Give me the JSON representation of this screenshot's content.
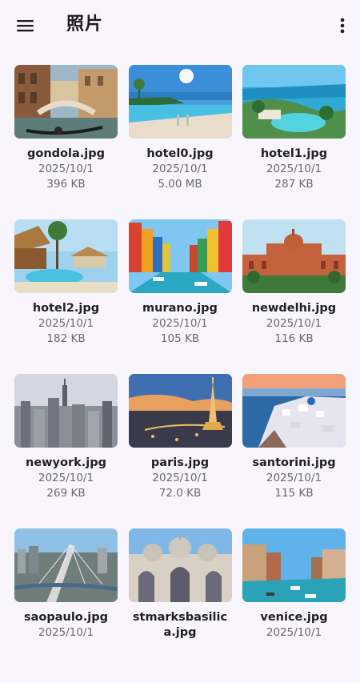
{
  "app_bar": {
    "title": "照片",
    "menu_icon": "menu-icon",
    "more_icon": "more-vert-icon"
  },
  "photos": [
    {
      "name": "gondola.jpg",
      "date": "2025/10/1",
      "size": "396 KB",
      "scene": "venice-canal-gondola"
    },
    {
      "name": "hotel0.jpg",
      "date": "2025/10/1",
      "size": "5.00 MB",
      "scene": "hotel-pool-sea"
    },
    {
      "name": "hotel1.jpg",
      "date": "2025/10/1",
      "size": "287 KB",
      "scene": "resort-aerial-bay"
    },
    {
      "name": "hotel2.jpg",
      "date": "2025/10/1",
      "size": "182 KB",
      "scene": "tropical-huts-pool"
    },
    {
      "name": "murano.jpg",
      "date": "2025/10/1",
      "size": "105 KB",
      "scene": "colorful-canal-houses"
    },
    {
      "name": "newdelhi.jpg",
      "date": "2025/10/1",
      "size": "116 KB",
      "scene": "red-sandstone-palace"
    },
    {
      "name": "newyork.jpg",
      "date": "2025/10/1",
      "size": "269 KB",
      "scene": "city-skyline-dusk"
    },
    {
      "name": "paris.jpg",
      "date": "2025/10/1",
      "size": "72.0 KB",
      "scene": "eiffel-tower-night"
    },
    {
      "name": "santorini.jpg",
      "date": "2025/10/1",
      "size": "115 KB",
      "scene": "whitewashed-cliff-village"
    },
    {
      "name": "saopaulo.jpg",
      "date": "2025/10/1",
      "size": "",
      "scene": "cable-bridge-city"
    },
    {
      "name": "stmarksbasilica.jpg",
      "date": "",
      "size": "",
      "scene": "basilica-facade"
    },
    {
      "name": "venice.jpg",
      "date": "2025/10/1",
      "size": "",
      "scene": "grand-canal-boats"
    }
  ]
}
